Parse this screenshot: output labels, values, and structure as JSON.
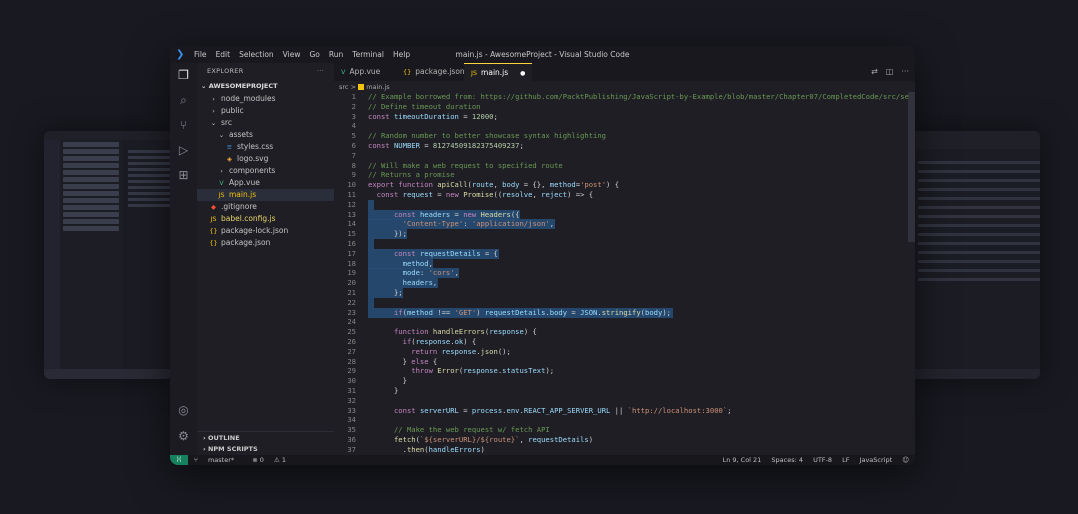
{
  "window": {
    "title": "main.js - AwesomeProject - Visual Studio Code",
    "menu": [
      "File",
      "Edit",
      "Selection",
      "View",
      "Go",
      "Run",
      "Terminal",
      "Help"
    ]
  },
  "explorer": {
    "header": "EXPLORER",
    "more": "···",
    "project": "AWESOMEPROJECT",
    "items": [
      {
        "label": "node_modules",
        "type": "folder",
        "depth": 1,
        "expanded": false
      },
      {
        "label": "public",
        "type": "folder",
        "depth": 1,
        "expanded": false
      },
      {
        "label": "src",
        "type": "folder",
        "depth": 1,
        "expanded": true
      },
      {
        "label": "assets",
        "type": "folder",
        "depth": 2,
        "expanded": true
      },
      {
        "label": "styles.css",
        "type": "css",
        "depth": 3
      },
      {
        "label": "logo.svg",
        "type": "svg",
        "depth": 3
      },
      {
        "label": "components",
        "type": "folder",
        "depth": 2,
        "expanded": false
      },
      {
        "label": "App.vue",
        "type": "vue",
        "depth": 2
      },
      {
        "label": "main.js",
        "type": "js",
        "depth": 2,
        "selected": true
      },
      {
        "label": ".gitignore",
        "type": "git",
        "depth": 1
      },
      {
        "label": "babel.config.js",
        "type": "js",
        "depth": 1
      },
      {
        "label": "package-lock.json",
        "type": "json",
        "depth": 1
      },
      {
        "label": "package.json",
        "type": "json",
        "depth": 1
      }
    ],
    "outline": "OUTLINE",
    "npm_scripts": "NPM SCRIPTS"
  },
  "tabs": [
    {
      "label": "App.vue",
      "icon": "V",
      "color": "#41b883"
    },
    {
      "label": "package.json",
      "icon": "{}",
      "color": "#f1c40f"
    },
    {
      "label": "main.js",
      "icon": "JS",
      "color": "#f1c40f",
      "active": true,
      "dirty": "●"
    }
  ],
  "breadcrumb": {
    "folder": "src",
    "sep": ">",
    "file": "main.js"
  },
  "code": {
    "start_line": 1,
    "highlighted_lines": [
      12,
      13,
      14,
      15,
      16,
      17,
      18,
      19,
      20,
      21,
      22,
      23
    ],
    "lines": [
      [
        [
          "// Example borrowed from: https://github.com/PacktPublishing/JavaScript-by-Example/blob/master/Chapter07/CompletedCode/src/se",
          "c"
        ]
      ],
      [
        [
          "// Define timeout duration",
          "c"
        ]
      ],
      [
        [
          "const ",
          "k"
        ],
        [
          "timeoutDuration",
          "v"
        ],
        [
          " = ",
          "p"
        ],
        [
          "12000",
          "n"
        ],
        [
          ";",
          "p"
        ]
      ],
      [
        [
          "",
          ""
        ]
      ],
      [
        [
          "// Random number to better showcase syntax highlighting",
          "c"
        ]
      ],
      [
        [
          "const ",
          "k"
        ],
        [
          "NUMBER",
          "v"
        ],
        [
          " = ",
          "p"
        ],
        [
          "81274509182375409237",
          "n"
        ],
        [
          ";",
          "p"
        ]
      ],
      [
        [
          "",
          ""
        ]
      ],
      [
        [
          "// Will make a web request to specified route",
          "c"
        ]
      ],
      [
        [
          "// Returns a promise",
          "c"
        ]
      ],
      [
        [
          "export function ",
          "k"
        ],
        [
          "apiCall",
          "f"
        ],
        [
          "(",
          "p"
        ],
        [
          "route",
          "v"
        ],
        [
          ", ",
          "p"
        ],
        [
          "body",
          "v"
        ],
        [
          " = {}, ",
          "p"
        ],
        [
          "method",
          "v"
        ],
        [
          "=",
          "p"
        ],
        [
          "'post'",
          "s"
        ],
        [
          ") {",
          "p"
        ]
      ],
      [
        [
          "  const ",
          "k"
        ],
        [
          "request",
          "v"
        ],
        [
          " = ",
          "p"
        ],
        [
          "new ",
          "k"
        ],
        [
          "Promise",
          "f"
        ],
        [
          "((",
          "p"
        ],
        [
          "resolve",
          "v"
        ],
        [
          ", ",
          "p"
        ],
        [
          "reject",
          "v"
        ],
        [
          ") => {",
          "p"
        ]
      ],
      [
        [
          "",
          ""
        ]
      ],
      [
        [
          "      const ",
          "k"
        ],
        [
          "headers",
          "v"
        ],
        [
          " = ",
          "p"
        ],
        [
          "new ",
          "k"
        ],
        [
          "Headers",
          "f"
        ],
        [
          "({",
          "p"
        ]
      ],
      [
        [
          "        ",
          "p"
        ],
        [
          "'Content-Type'",
          "s"
        ],
        [
          ": ",
          "p"
        ],
        [
          "'application/json'",
          "s"
        ],
        [
          ",",
          "p"
        ]
      ],
      [
        [
          "      });",
          "p"
        ]
      ],
      [
        [
          "",
          ""
        ]
      ],
      [
        [
          "      const ",
          "k"
        ],
        [
          "requestDetails",
          "v"
        ],
        [
          " = {",
          "p"
        ]
      ],
      [
        [
          "        method",
          "v"
        ],
        [
          ",",
          "p"
        ]
      ],
      [
        [
          "        mode",
          "v"
        ],
        [
          ": ",
          "p"
        ],
        [
          "'cors'",
          "s"
        ],
        [
          ",",
          "p"
        ]
      ],
      [
        [
          "        headers",
          "v"
        ],
        [
          ",",
          "p"
        ]
      ],
      [
        [
          "      };",
          "p"
        ]
      ],
      [
        [
          "",
          ""
        ]
      ],
      [
        [
          "      if",
          "k"
        ],
        [
          "(",
          "p"
        ],
        [
          "method",
          "v"
        ],
        [
          " !== ",
          "p"
        ],
        [
          "'GET'",
          "s"
        ],
        [
          ") ",
          "p"
        ],
        [
          "requestDetails",
          "v"
        ],
        [
          ".",
          "p"
        ],
        [
          "body",
          "v"
        ],
        [
          " = ",
          "p"
        ],
        [
          "JSON",
          "v"
        ],
        [
          ".",
          "p"
        ],
        [
          "stringify",
          "f"
        ],
        [
          "(",
          "p"
        ],
        [
          "body",
          "v"
        ],
        [
          ");",
          "p"
        ]
      ],
      [
        [
          "",
          ""
        ]
      ],
      [
        [
          "      function ",
          "k"
        ],
        [
          "handleErrors",
          "f"
        ],
        [
          "(",
          "p"
        ],
        [
          "response",
          "v"
        ],
        [
          ") {",
          "p"
        ]
      ],
      [
        [
          "        if",
          "k"
        ],
        [
          "(",
          "p"
        ],
        [
          "response",
          "v"
        ],
        [
          ".",
          "p"
        ],
        [
          "ok",
          "v"
        ],
        [
          ") {",
          "p"
        ]
      ],
      [
        [
          "          return ",
          "k"
        ],
        [
          "response",
          "v"
        ],
        [
          ".",
          "p"
        ],
        [
          "json",
          "f"
        ],
        [
          "();",
          "p"
        ]
      ],
      [
        [
          "        } ",
          "p"
        ],
        [
          "else ",
          "k"
        ],
        [
          "{",
          "p"
        ]
      ],
      [
        [
          "          throw ",
          "k"
        ],
        [
          "Error",
          "f"
        ],
        [
          "(",
          "p"
        ],
        [
          "response",
          "v"
        ],
        [
          ".",
          "p"
        ],
        [
          "statusText",
          "v"
        ],
        [
          ");",
          "p"
        ]
      ],
      [
        [
          "        }",
          "p"
        ]
      ],
      [
        [
          "      }",
          "p"
        ]
      ],
      [
        [
          "",
          ""
        ]
      ],
      [
        [
          "      const ",
          "k"
        ],
        [
          "serverURL",
          "v"
        ],
        [
          " = ",
          "p"
        ],
        [
          "process",
          "v"
        ],
        [
          ".",
          "p"
        ],
        [
          "env",
          "v"
        ],
        [
          ".",
          "p"
        ],
        [
          "REACT_APP_SERVER_URL",
          "v"
        ],
        [
          " || ",
          "p"
        ],
        [
          "`http://localhost:3000`",
          "s"
        ],
        [
          ";",
          "p"
        ]
      ],
      [
        [
          "",
          ""
        ]
      ],
      [
        [
          "      // Make the web request w/ fetch API",
          "c"
        ]
      ],
      [
        [
          "      fetch",
          "f"
        ],
        [
          "(",
          "p"
        ],
        [
          "`${serverURL}/${route}`",
          "s"
        ],
        [
          ", ",
          "p"
        ],
        [
          "requestDetails",
          "v"
        ],
        [
          ")",
          "p"
        ]
      ],
      [
        [
          "        .",
          "p"
        ],
        [
          "then",
          "f"
        ],
        [
          "(",
          "p"
        ],
        [
          "handleErrors",
          "v"
        ],
        [
          ")",
          "p"
        ]
      ]
    ]
  },
  "status": {
    "remote": "⟩⟨",
    "branch": "master*",
    "errors": "⊗ 0",
    "warnings": "⚠ 1",
    "position": "Ln 9, Col 21",
    "spaces": "Spaces: 4",
    "encoding": "UTF-8",
    "eol": "LF",
    "language": "JavaScript",
    "feedback": "☺"
  },
  "colors": {
    "comment": "#6a9955",
    "keyword": "#c586c0",
    "variable": "#9cdcfe",
    "function": "#dcdcaa",
    "string": "#ce9178",
    "number": "#b5cea8",
    "punct": "#d4d4d4",
    "accent": "#3b8eea",
    "highlight": "#264f78"
  }
}
